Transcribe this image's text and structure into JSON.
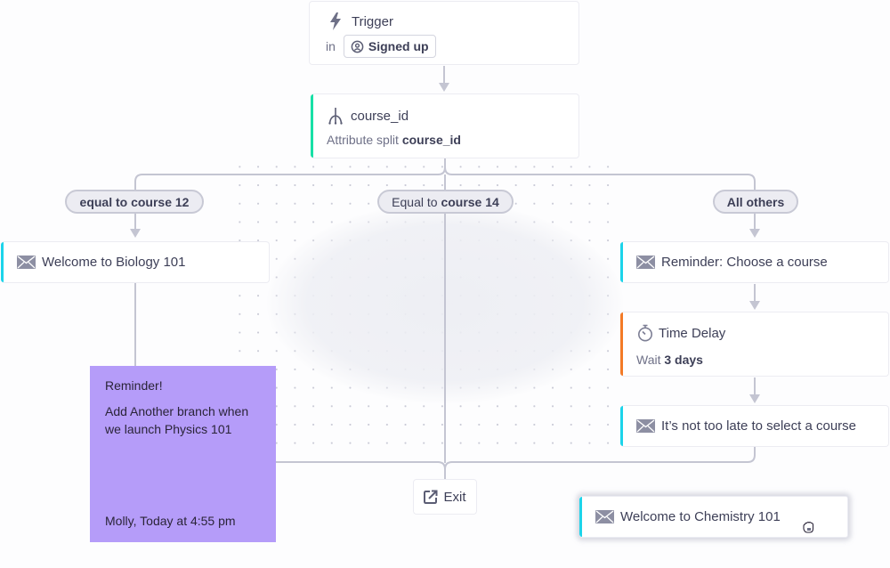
{
  "trigger": {
    "title": "Trigger",
    "in_label": "in",
    "segment": "Signed up",
    "icon": "lightning-icon",
    "segment_icon": "user-circle-icon"
  },
  "split": {
    "title": "course_id",
    "subtitle_prefix": "Attribute split",
    "subtitle_attr": "course_id",
    "icon": "split-icon",
    "accent": "#17e0a6"
  },
  "branches": [
    {
      "label_prefix": "",
      "label_bold": "equal to course 12"
    },
    {
      "label_prefix": "Equal to ",
      "label_bold": "course 14"
    },
    {
      "label_prefix": "",
      "label_bold": "All others"
    }
  ],
  "nodes": {
    "biology": {
      "title": "Welcome to Biology 101",
      "icon": "envelope-icon",
      "accent": "#1cd4ea"
    },
    "reminder_choose": {
      "title": "Reminder: Choose a course",
      "icon": "envelope-icon",
      "accent": "#1cd4ea"
    },
    "time_delay": {
      "title": "Time Delay",
      "wait_prefix": "Wait",
      "wait_value": "3 days",
      "icon": "stopwatch-icon",
      "accent": "#f37a26"
    },
    "not_too_late": {
      "title": "It’s not too late to select a course",
      "icon": "envelope-icon",
      "accent": "#1cd4ea"
    },
    "chemistry": {
      "title": "Welcome to Chemistry 101",
      "icon": "envelope-icon",
      "accent": "#1cd4ea"
    }
  },
  "note": {
    "heading": "Reminder!",
    "body": "Add Another branch when we launch Physics 101",
    "author": "Molly, Today at 4:55 pm",
    "color": "#b59cf9"
  },
  "exit": {
    "label": "Exit",
    "icon": "external-link-icon"
  },
  "cursor": {
    "icon": "grab-hand-icon"
  }
}
